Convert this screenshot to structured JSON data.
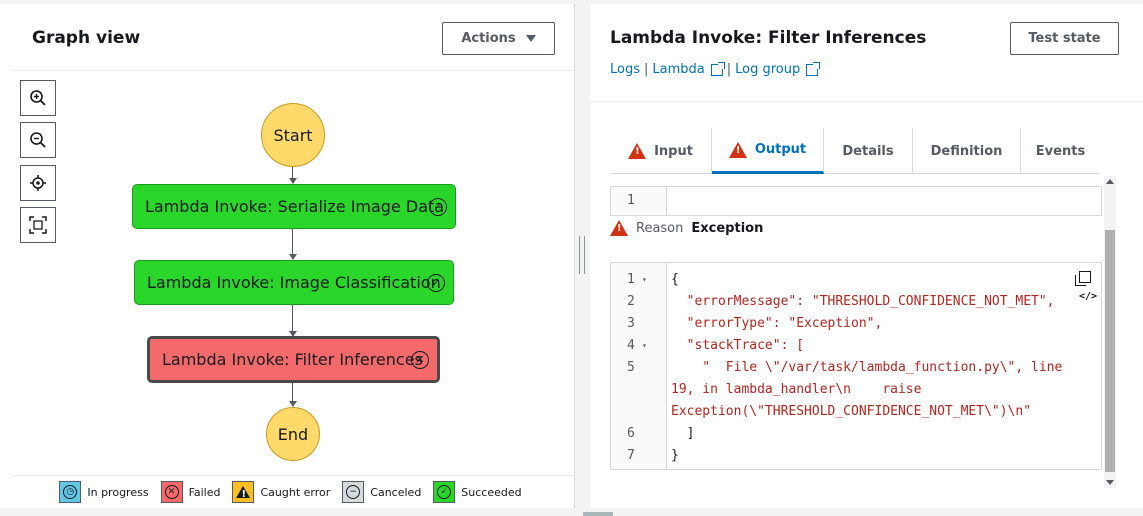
{
  "left": {
    "title": "Graph view",
    "actions_label": "Actions"
  },
  "graph": {
    "start": "Start",
    "end": "End",
    "nodes": [
      {
        "label": "Lambda Invoke: Serialize Image Data",
        "status": "succeeded"
      },
      {
        "label": "Lambda Invoke: Image Classification",
        "status": "succeeded"
      },
      {
        "label": "Lambda Invoke: Filter Inferences",
        "status": "failed"
      }
    ],
    "colors": {
      "succeeded": "#2bd62b",
      "failed": "#f46a6a",
      "terminal": "#ffd96a"
    }
  },
  "legend": [
    {
      "label": "In progress",
      "color": "#5fc8e8",
      "glyph": "◷"
    },
    {
      "label": "Failed",
      "color": "#f46a6a",
      "glyph": "✕"
    },
    {
      "label": "Caught error",
      "color": "#ffbf24",
      "glyph": "!"
    },
    {
      "label": "Canceled",
      "color": "#d5dbdb",
      "glyph": "−"
    },
    {
      "label": "Succeeded",
      "color": "#2bd62b",
      "glyph": "✓"
    }
  ],
  "right": {
    "title": "Lambda Invoke: Filter Inferences",
    "test_state_label": "Test state",
    "links": {
      "logs": "Logs",
      "lambda": "Lambda",
      "log_group": "Log group"
    },
    "tabs": [
      {
        "label": "Input",
        "warning": true
      },
      {
        "label": "Output",
        "warning": true,
        "active": true
      },
      {
        "label": "Details"
      },
      {
        "label": "Definition"
      },
      {
        "label": "Events"
      }
    ],
    "input_line_number": "1",
    "reason_label": "Reason",
    "reason_value": "Exception",
    "code_lines": [
      {
        "n": "1",
        "fold": true,
        "text": "{"
      },
      {
        "n": "2",
        "text": "  \"errorMessage\": \"THRESHOLD_CONFIDENCE_NOT_MET\","
      },
      {
        "n": "3",
        "text": "  \"errorType\": \"Exception\","
      },
      {
        "n": "4",
        "fold": true,
        "text": "  \"stackTrace\": ["
      },
      {
        "n": "5",
        "text": "    \"  File \\\"/var/task/lambda_function.py\\\", line"
      },
      {
        "n": "",
        "text": "19, in lambda_handler\\n    raise"
      },
      {
        "n": "",
        "text": "Exception(\\\"THRESHOLD_CONFIDENCE_NOT_MET\\\")\\n\""
      },
      {
        "n": "6",
        "text": "  ]"
      },
      {
        "n": "7",
        "text": "}"
      }
    ]
  }
}
